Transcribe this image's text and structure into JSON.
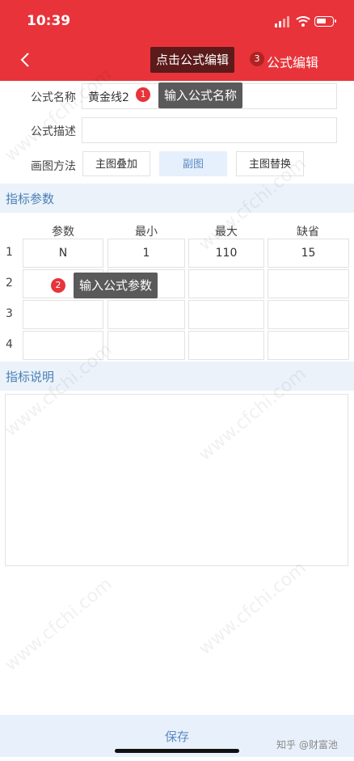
{
  "status_bar": {
    "time": "10:39"
  },
  "nav": {
    "title": "点击公式编辑",
    "action": "公式编辑"
  },
  "callouts": [
    {
      "number": "1",
      "text": "输入公式名称"
    },
    {
      "number": "2",
      "text": "输入公式参数"
    },
    {
      "number": "3",
      "text": "点击公式编辑"
    }
  ],
  "form": {
    "name_label": "公式名称",
    "name_value": "黄金线2",
    "desc_label": "公式描述",
    "desc_value": "",
    "draw_label": "画图方法",
    "draw_options": [
      "主图叠加",
      "副图",
      "主图替换"
    ],
    "draw_selected": "副图"
  },
  "params_section": {
    "title": "指标参数",
    "headers": [
      "参数",
      "最小",
      "最大",
      "缺省"
    ],
    "rows": [
      {
        "num": "1",
        "cells": [
          "N",
          "1",
          "110",
          "15"
        ]
      },
      {
        "num": "2",
        "cells": [
          "",
          "",
          "",
          ""
        ]
      },
      {
        "num": "3",
        "cells": [
          "",
          "",
          "",
          ""
        ]
      },
      {
        "num": "4",
        "cells": [
          "",
          "",
          "",
          ""
        ]
      }
    ]
  },
  "desc_section": {
    "title": "指标说明",
    "content": ""
  },
  "footer": {
    "save_label": "保存",
    "credit": "知乎 @财富池"
  },
  "watermark": "www.cfchi.com",
  "colors": {
    "brand_red": "#e8333a",
    "section_blue": "#4a7fb6",
    "active_bg": "#e6f0fc"
  }
}
